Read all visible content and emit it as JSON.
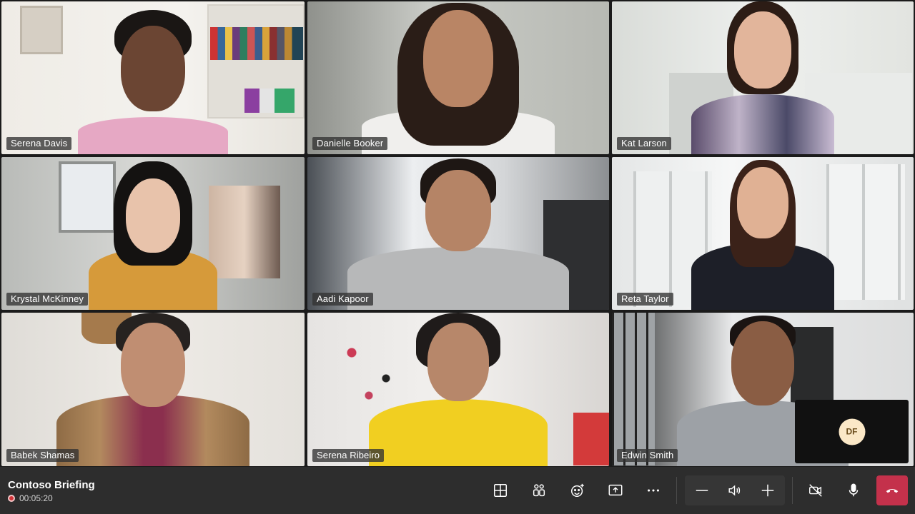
{
  "participants": [
    {
      "name": "Serena Davis"
    },
    {
      "name": "Danielle Booker"
    },
    {
      "name": "Kat Larson"
    },
    {
      "name": "Krystal McKinney"
    },
    {
      "name": "Aadi Kapoor"
    },
    {
      "name": "Reta Taylor"
    },
    {
      "name": "Babek Shamas"
    },
    {
      "name": "Serena Ribeiro"
    },
    {
      "name": "Edwin Smith"
    }
  ],
  "self_view": {
    "initials": "DF"
  },
  "meeting": {
    "title": "Contoso Briefing",
    "elapsed": "00:05:20",
    "recording": true
  },
  "controls": {
    "icons": [
      "grid-layout-icon",
      "participants-icon",
      "reactions-icon",
      "share-screen-icon",
      "more-options-icon",
      "volume-down-icon",
      "speaker-icon",
      "volume-up-icon",
      "camera-off-icon",
      "microphone-icon",
      "hang-up-icon"
    ]
  },
  "colors": {
    "bar": "#2d2d2d",
    "hangup": "#c4314b",
    "recording": "#d13438",
    "avatar_bg": "#fbe8c7"
  }
}
